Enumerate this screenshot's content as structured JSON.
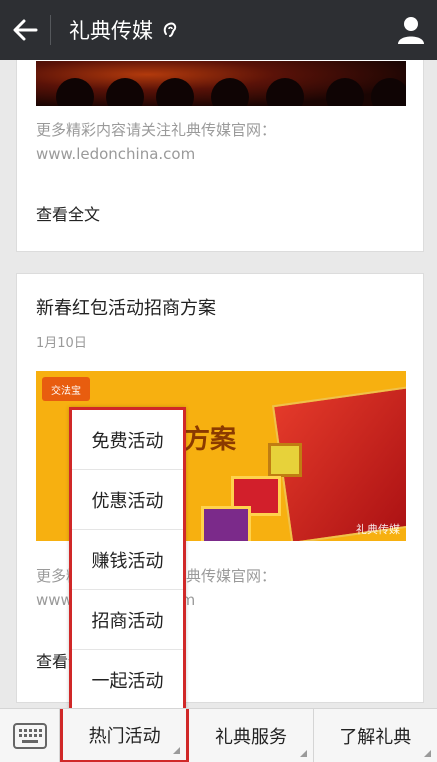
{
  "header": {
    "title": "礼典传媒",
    "back_icon": "back-arrow-icon",
    "person_icon": "person-icon",
    "ear_icon": "ear-icon"
  },
  "articles": [
    {
      "summary": "更多精彩内容请关注礼典传媒官网：www.ledonchina.com",
      "read_all": "查看全文"
    },
    {
      "title": "新春红包活动招商方案",
      "date": "1月10日",
      "image_logo": "交法宝",
      "image_text": "方案",
      "image_watermark": "礼典传媒",
      "summary": "更多精彩内容请关注礼典传媒官网：www.ledonchina.com",
      "read_all": "查看全文"
    }
  ],
  "popup_menu": {
    "items": [
      "免费活动",
      "优惠活动",
      "赚钱活动",
      "招商活动",
      "一起活动"
    ]
  },
  "bottom_bar": {
    "keyboard_icon": "keyboard-icon",
    "tabs": [
      "热门活动",
      "礼典服务",
      "了解礼典"
    ]
  },
  "colors": {
    "topbar": "#2d2f33",
    "highlight": "#d02828"
  }
}
